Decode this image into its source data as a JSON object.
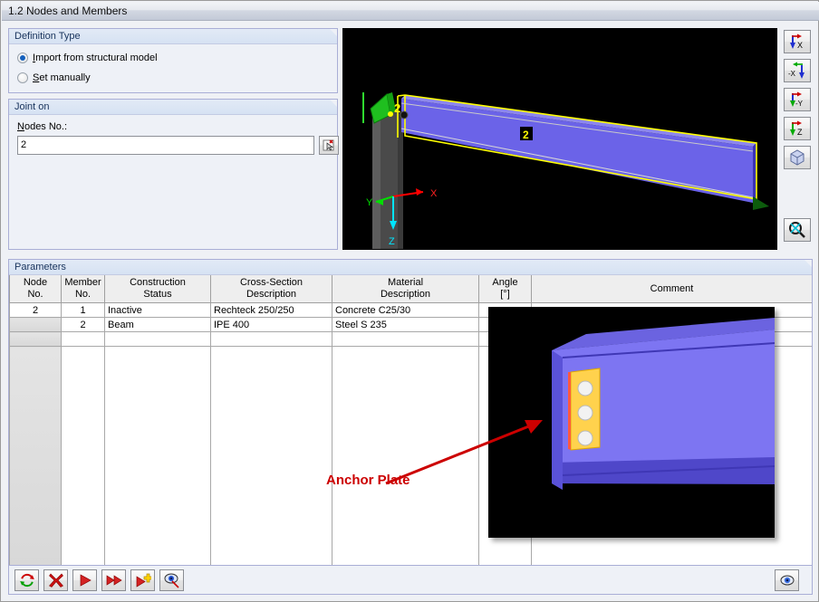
{
  "window": {
    "title": "1.2 Nodes and Members"
  },
  "definition_type": {
    "legend": "Definition Type",
    "options": [
      {
        "label": "Import from structural model",
        "accel": "I",
        "rest": "mport from structural model",
        "selected": true
      },
      {
        "label": "Set manually",
        "accel": "S",
        "rest": "et manually",
        "selected": false
      }
    ]
  },
  "joint_on": {
    "legend": "Joint on",
    "field_label": "Nodes No.:",
    "field_accel": "N",
    "field_label_rest": "odes No.:",
    "value": "2",
    "pick_button_name": "pick-node-icon"
  },
  "viewport": {
    "node_label": "2",
    "member_label": "2",
    "axis_x": "X",
    "axis_y": "Y",
    "axis_z": "Z",
    "background": "#000000",
    "member_color": "#6b63e8",
    "member_outline": "#ffff00",
    "column_color": "#4d4d4d",
    "support_color": "#00c000"
  },
  "view_toolbar": [
    {
      "name": "view-in-x-direction",
      "label": "X"
    },
    {
      "name": "view-in-minus-x-direction",
      "label": "-X"
    },
    {
      "name": "view-in-minus-y-direction",
      "label": "-Y"
    },
    {
      "name": "view-in-z-direction",
      "label": "Z"
    },
    {
      "name": "isometric-view",
      "label": ""
    },
    {
      "name": "zoom-all",
      "label": ""
    }
  ],
  "parameters": {
    "legend": "Parameters",
    "columns": [
      {
        "line1": "Node",
        "line2": "No."
      },
      {
        "line1": "Member",
        "line2": "No."
      },
      {
        "line1": "Construction",
        "line2": "Status"
      },
      {
        "line1": "Cross-Section",
        "line2": "Description"
      },
      {
        "line1": "Material",
        "line2": "Description"
      },
      {
        "line1": "Angle",
        "line2": "[°]"
      },
      {
        "line1": "Comment",
        "line2": ""
      }
    ],
    "rows": [
      {
        "node_no": "2",
        "member_no": "1",
        "construction_status": "Inactive",
        "cross_section": "Rechteck 250/250",
        "material": "Concrete C25/30",
        "angle": "",
        "comment": ""
      },
      {
        "node_no": "",
        "member_no": "2",
        "construction_status": "Beam",
        "cross_section": "IPE 400",
        "material": "Steel S 235",
        "angle": "",
        "comment": ""
      }
    ]
  },
  "annotation": {
    "anchor_plate_label": "Anchor Plate",
    "label_color": "#cc0000",
    "arrow_color": "#cc0000"
  },
  "anchor_picture": {
    "beam_color": "#7a72f0",
    "plate_color": "#ffd966",
    "bolt_color": "#ffffff",
    "background": "#000000"
  },
  "bottom_toolbar": {
    "buttons": [
      {
        "name": "refresh-button",
        "icon": "refresh-icon"
      },
      {
        "name": "delete-button",
        "icon": "red-x-icon"
      },
      {
        "name": "next-button",
        "icon": "arrow-right-icon"
      },
      {
        "name": "skip-button",
        "icon": "double-arrow-right-icon"
      },
      {
        "name": "add-button",
        "icon": "arrow-plus-icon"
      },
      {
        "name": "view-details-button",
        "icon": "eye-icon"
      }
    ],
    "right_button": {
      "name": "visibility-button",
      "icon": "eye-icon"
    }
  }
}
